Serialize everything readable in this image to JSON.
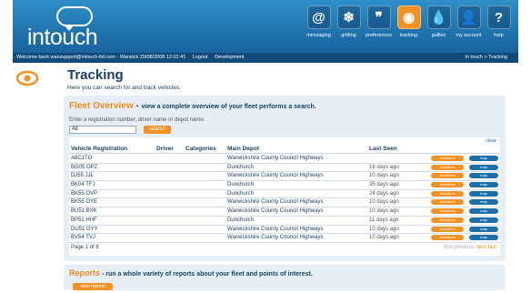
{
  "app": {
    "logo_text": "intouch"
  },
  "nav": [
    {
      "label": "messaging",
      "icon": "at-icon",
      "glyph": "@"
    },
    {
      "label": "gritting",
      "icon": "snowflake-icon",
      "glyph": "❄"
    },
    {
      "label": "preferences",
      "icon": "quote-icon",
      "glyph": "❞"
    },
    {
      "label": "tracking",
      "icon": "eye-icon",
      "glyph": "◉",
      "active": true
    },
    {
      "label": "gullies",
      "icon": "drop-icon",
      "glyph": "💧"
    },
    {
      "label": "my account",
      "icon": "user-icon",
      "glyph": "👤"
    },
    {
      "label": "help",
      "icon": "question-icon",
      "glyph": "?"
    }
  ],
  "status": {
    "welcome": "Welcome back wansupport@intouch-ltd.com - Warwick 20/08/2008 12:01:41",
    "logout": "Logout",
    "dev": "Development",
    "breadcrumb": "In touch > Tracking"
  },
  "page": {
    "title": "Tracking",
    "subtitle": "Here you can search for and track vehicles."
  },
  "fleet": {
    "heading": "Fleet Overview",
    "dash": " - ",
    "subheading": "view a complete overview of your fleet performs a search.",
    "hint": "Enter a registration number, driver name or depot name:",
    "search_value": "All",
    "search_label": "search",
    "clear_label": "clear",
    "columns": [
      "Vehicle Registration",
      "Driver",
      "Categories",
      "Main Depot",
      "Last Seen"
    ],
    "rows": [
      {
        "reg": "A6C1TO",
        "depot": "Warwickshire County Council Highways",
        "seen": ""
      },
      {
        "reg": "BG05 OPZ",
        "depot": "Dunchurch",
        "seen": "16 days ago"
      },
      {
        "reg": "DJ55 JJL",
        "depot": "Warwickshire County Council Highways",
        "seen": "10 days ago"
      },
      {
        "reg": "BK04 TFJ",
        "depot": "Dunchurch",
        "seen": "35 days ago"
      },
      {
        "reg": "BK55 OVP",
        "depot": "Dunchurch",
        "seen": "24 days ago"
      },
      {
        "reg": "BK55 OYE",
        "depot": "Warwickshire County Council Highways",
        "seen": "10 days ago"
      },
      {
        "reg": "BU51 BXK",
        "depot": "Warwickshire County Council Highways",
        "seen": "10 days ago"
      },
      {
        "reg": "BP51 HHF",
        "depot": "Dunchurch",
        "seen": "11 days ago"
      },
      {
        "reg": "DU51 GYY",
        "depot": "Warwickshire County Council Highways",
        "seen": "10 days ago"
      },
      {
        "reg": "BV54 TVJ",
        "depot": "Warwickshire County Council Highways",
        "seen": "10 days ago"
      }
    ],
    "row_action_1": "directions",
    "row_action_2": "map",
    "pager_info": "Page 1 of 8",
    "pager_first": "first",
    "pager_previous": "previous",
    "pager_next": "next",
    "pager_last": "last"
  },
  "reports": {
    "heading": "Reports",
    "dash": " - ",
    "subheading": "run a whole variety of reports about your fleet and points of interest.",
    "button_label": "view reports"
  },
  "colors": {
    "brand_blue": "#1d6fa8",
    "accent_orange": "#f29224",
    "navy": "#1d3f64"
  }
}
